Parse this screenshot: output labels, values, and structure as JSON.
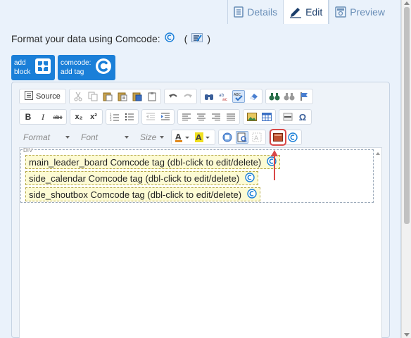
{
  "tabs": [
    {
      "label": "Details",
      "icon": "document-icon",
      "active": false
    },
    {
      "label": "Edit",
      "icon": "pencil-icon",
      "active": true
    },
    {
      "label": "Preview",
      "icon": "preview-icon",
      "active": false
    }
  ],
  "format_line": {
    "text": "Format your data using Comcode:",
    "paren_open": "(",
    "paren_close": ")"
  },
  "buttons": {
    "add_block": {
      "line1": "add",
      "line2": "block"
    },
    "add_tag": {
      "line1": "comcode:",
      "line2": "add tag"
    }
  },
  "toolbar": {
    "source_label": "Source",
    "bold": "B",
    "italic": "I",
    "strike": "abc",
    "subscript": "x₂",
    "superscript": "x²",
    "special_char": "Ω",
    "format_combo": "Format",
    "font_combo": "Font",
    "size_combo": "Size"
  },
  "editor": {
    "div_label": "DIV",
    "tags": [
      "main_leader_board Comcode tag (dbl-click to edit/delete)",
      "side_calendar Comcode tag (dbl-click to edit/delete)",
      "side_shoutbox Comcode tag (dbl-click to edit/delete)"
    ]
  },
  "colors": {
    "accent": "#1a7fd8",
    "panel_bg": "#eaf2fb",
    "tag_bg": "#fdfbd4",
    "highlight": "#d94848"
  }
}
